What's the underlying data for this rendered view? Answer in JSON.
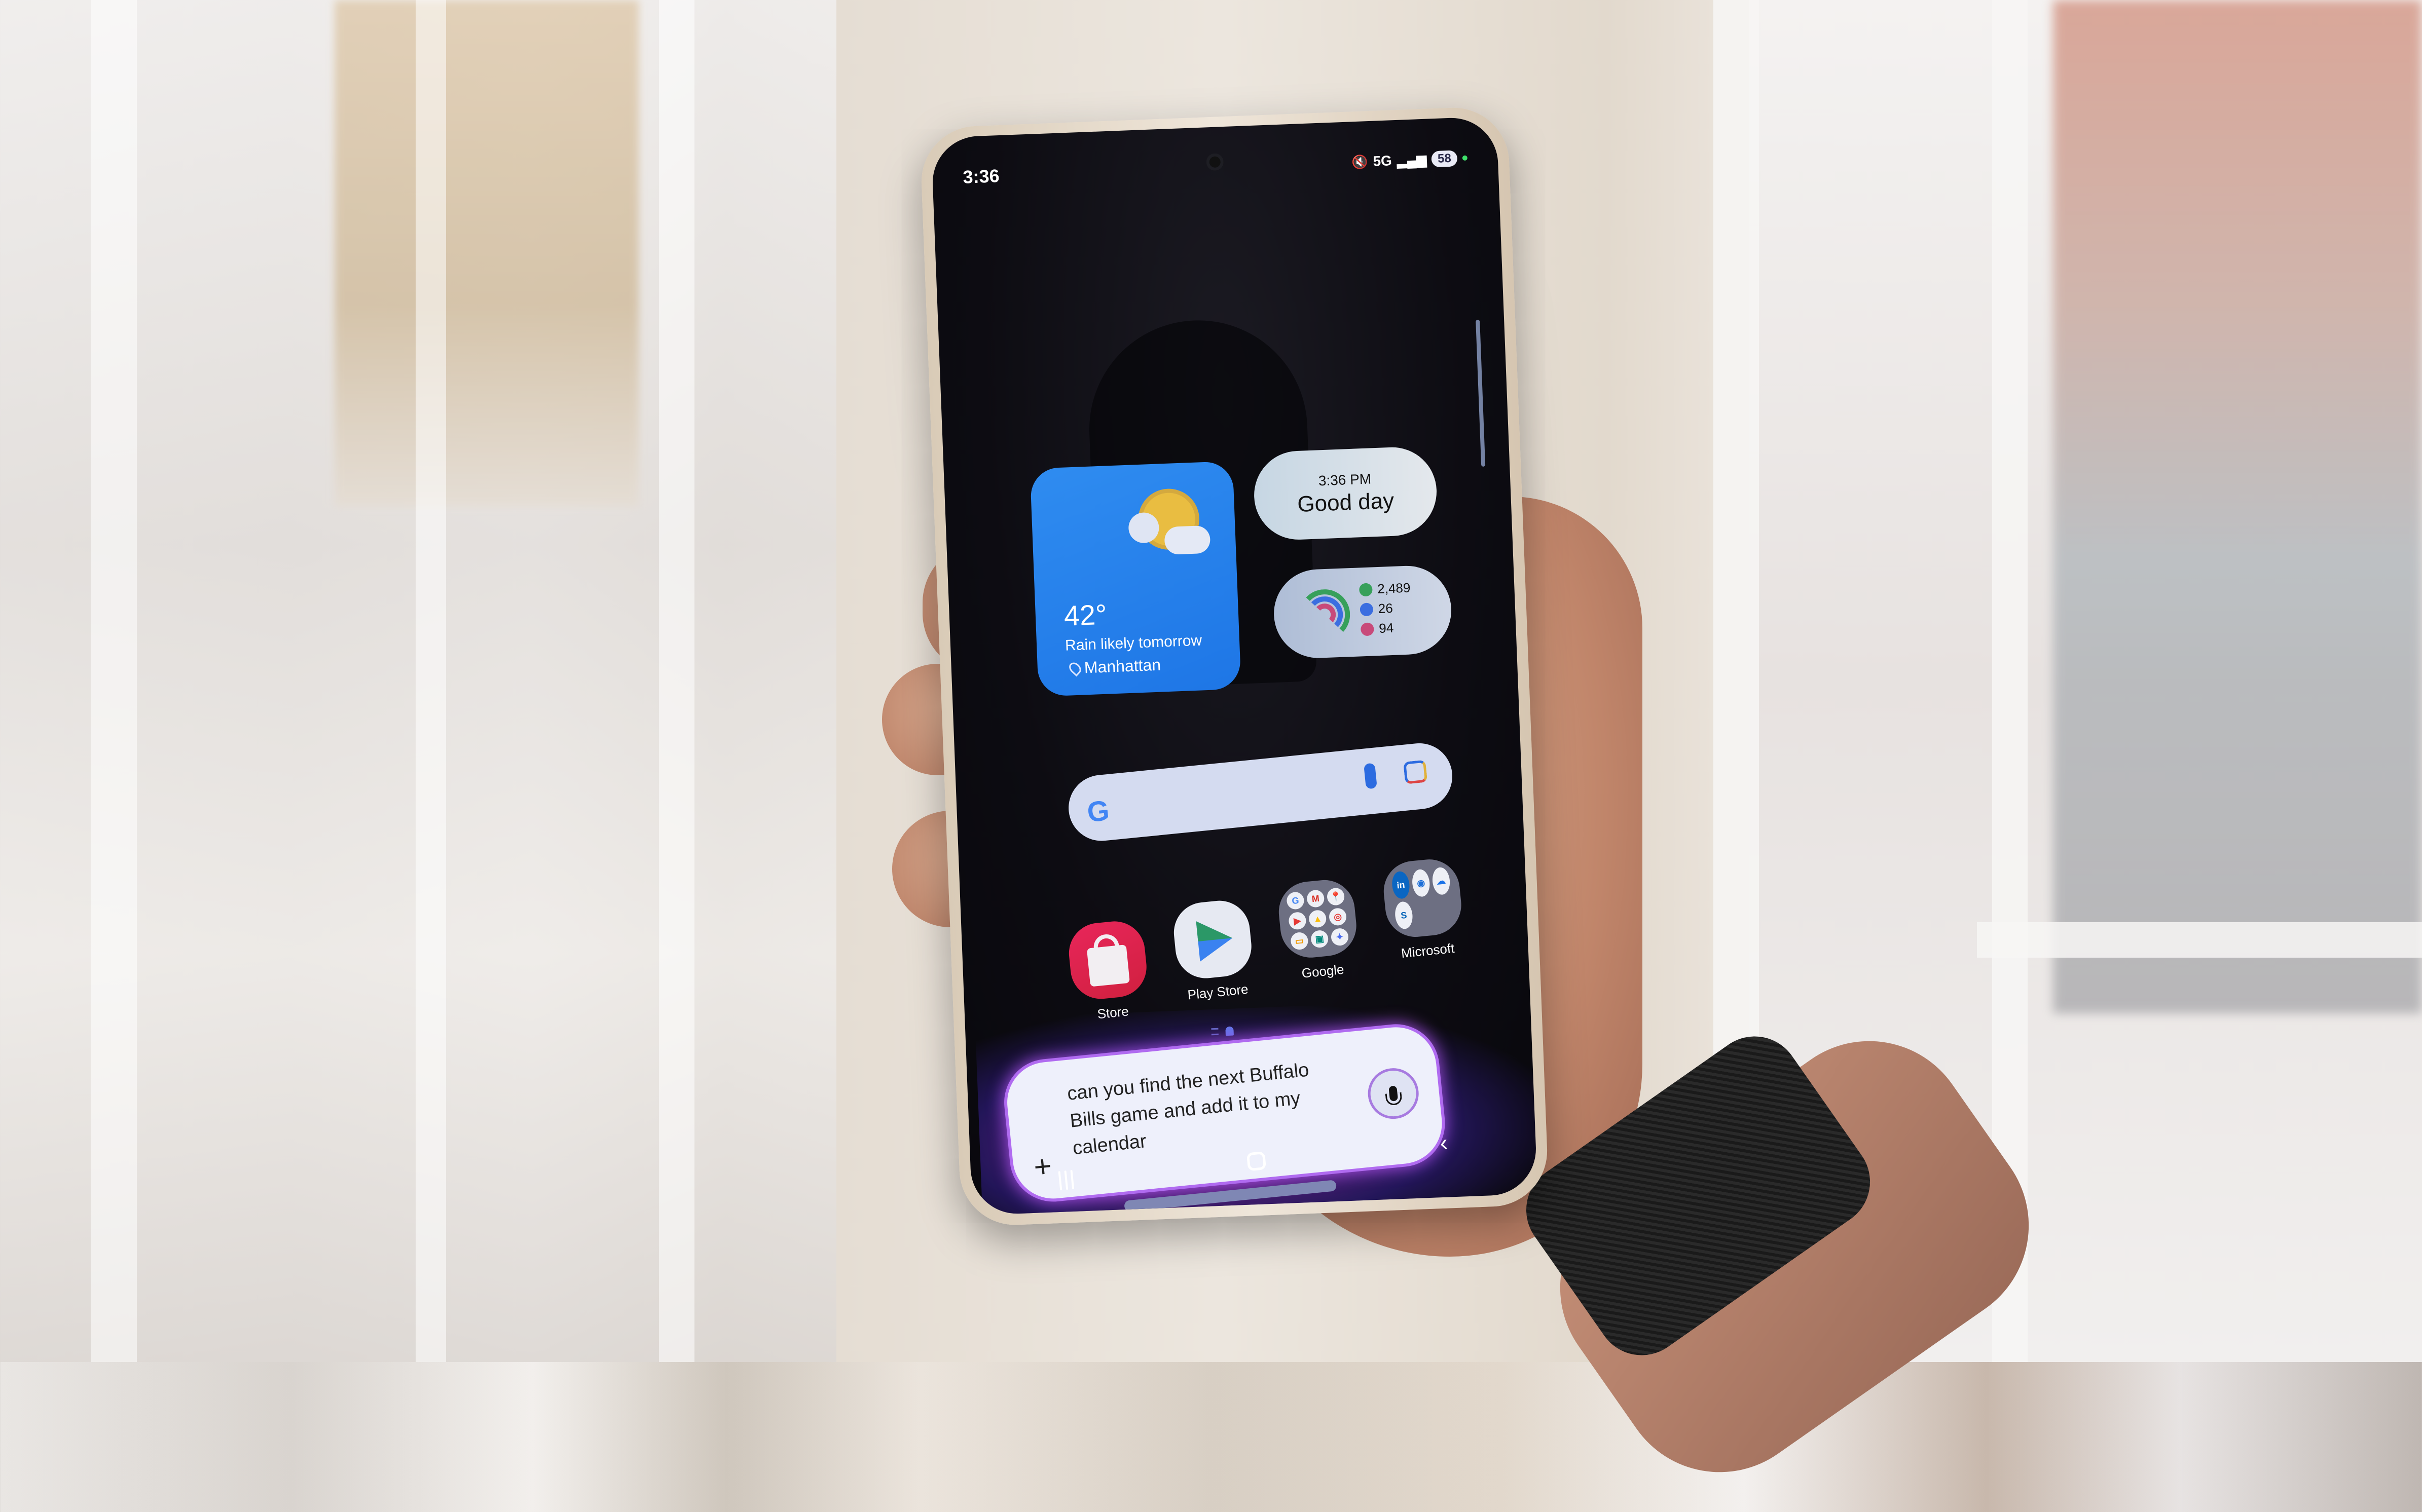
{
  "status_bar": {
    "time": "3:36",
    "network": "5G",
    "battery": "58",
    "icons": [
      "mute-icon",
      "signal-icon",
      "battery-icon"
    ]
  },
  "weather_widget": {
    "temperature": "42°",
    "description": "Rain likely tomorrow",
    "location": "Manhattan",
    "icon": "partly-cloudy-icon",
    "accent": "#1e76e6"
  },
  "clock_widget": {
    "time": "3:36 PM",
    "greeting": "Good day"
  },
  "health_widget": {
    "stats": [
      {
        "icon": "steps-icon",
        "value": "2,489",
        "color": "#37a05a"
      },
      {
        "icon": "active-time-icon",
        "value": "26",
        "color": "#3b6ee0"
      },
      {
        "icon": "calories-icon",
        "value": "94",
        "color": "#c84a7a"
      }
    ]
  },
  "search_bar": {
    "logo": "G",
    "icons": [
      "google-logo-icon",
      "mic-icon",
      "lens-icon"
    ]
  },
  "apps": [
    {
      "label": "Store",
      "icon": "shopping-bag-icon"
    },
    {
      "label": "Play Store",
      "icon": "play-store-icon"
    },
    {
      "label": "Google",
      "icon": "folder-icon",
      "contents": [
        "G",
        "M",
        "📍",
        "▶",
        "▲",
        "◎",
        "▭",
        "▣",
        "✦"
      ]
    },
    {
      "label": "Microsoft",
      "icon": "folder-icon",
      "contents": [
        "in",
        "◉",
        "☁",
        "S"
      ]
    }
  ],
  "gemini": {
    "query": "can you find the next Buffalo Bills game and add it to my calendar",
    "plus_label": "+",
    "accent": "#b06bf0"
  },
  "nav_bar": {
    "back": "‹"
  }
}
